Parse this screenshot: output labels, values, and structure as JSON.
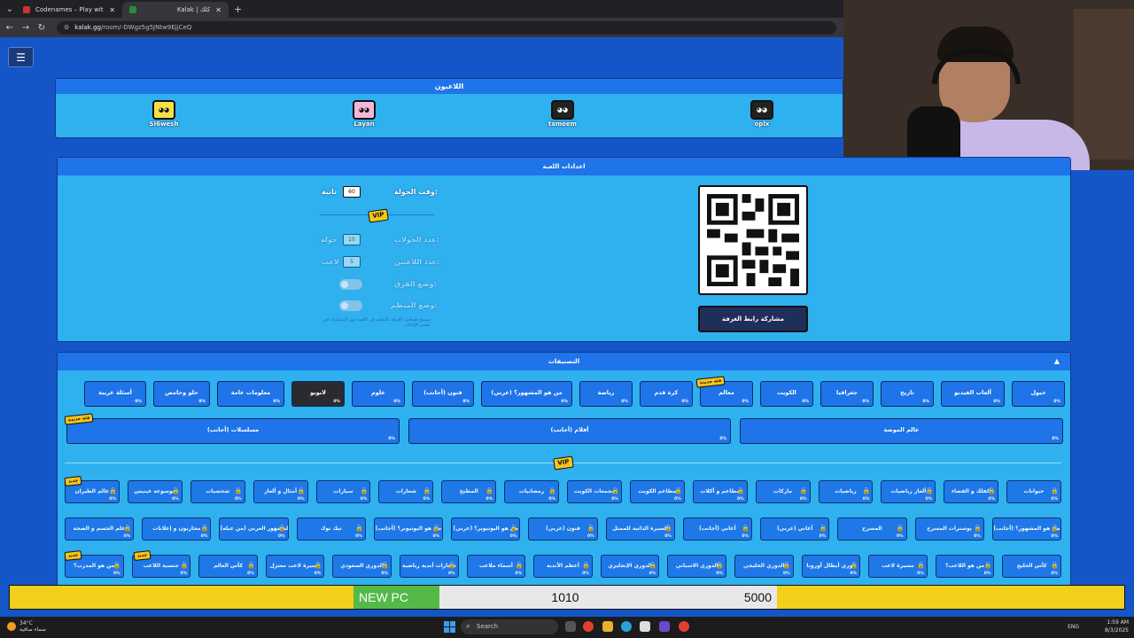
{
  "browser": {
    "tabs": [
      {
        "title": "Codenames – Play with your Fr"
      },
      {
        "title": "Kalak | كلك"
      }
    ],
    "new_tab": "+",
    "url_host": "kalak.gg",
    "url_path": "/room/-DWgz5g5JNtw9EjjCeQ"
  },
  "players": {
    "title": "اللاعبون",
    "list": [
      {
        "name": "SI6wesh",
        "color": "#f6e04a"
      },
      {
        "name": "Layan",
        "color": "#f3b6d6"
      },
      {
        "name": "tameem",
        "color": "#222222"
      },
      {
        "name": "oplx",
        "color": "#222222"
      }
    ]
  },
  "settings": {
    "title": "اعدادات اللعبة",
    "round_time_label": "وقت الجولة:",
    "round_time_value": "60",
    "round_time_unit": "ثانية",
    "vip": "VIP",
    "rounds_label": "عدد الجولات:",
    "rounds_value": "10",
    "rounds_unit": "جولة",
    "players_label": "عدد اللاعبين:",
    "players_value": "5",
    "players_unit": "لاعب",
    "teams_label": "وضع الفرق:",
    "host_label": "وضع المنظم:",
    "note": "يسمح لصاحب الغرفة بالتحكم في اللعبة دون المشاركة في تقديم الإجابات",
    "share_label": "مشاركة رابط الغرفة"
  },
  "categories": {
    "title": "التصنيفات",
    "new_badge": "فئة جديدة",
    "free_row": [
      {
        "label": "خيول",
        "pct": "0%"
      },
      {
        "label": "ألعاب الفيديو",
        "pct": "0%"
      },
      {
        "label": "تاريخ",
        "pct": "0%"
      },
      {
        "label": "جغرافيا",
        "pct": "0%"
      },
      {
        "label": "الكويت",
        "pct": "0%"
      },
      {
        "label": "معالم",
        "pct": "0%"
      },
      {
        "label": "كرة قدم",
        "pct": "0%"
      },
      {
        "label": "رياضة",
        "pct": "0%"
      },
      {
        "label": "من هو المشهور؟ (عربي)",
        "pct": "0%"
      },
      {
        "label": "فنون (أجانب)",
        "pct": "0%"
      },
      {
        "label": "علوم",
        "pct": "0%"
      },
      {
        "label": "لابوبو",
        "pct": "0%"
      },
      {
        "label": "معلومات عامة",
        "pct": "0%"
      },
      {
        "label": "حلو وحامض",
        "pct": "0%"
      },
      {
        "label": "أسئلة غريبة",
        "pct": "0%"
      }
    ],
    "wide_row": [
      {
        "label": "عالم الموضة",
        "pct": "0%"
      },
      {
        "label": "أفلام (أجانب)",
        "pct": "0%"
      },
      {
        "label": "مسلسلات (أجانب)",
        "pct": "0%"
      }
    ],
    "vip": "VIP",
    "vip_badge": "جديد",
    "vip_rows": [
      [
        "حيوانات",
        "الفلك و الفضاء",
        "ألغاز رياضيات",
        "رياضيات",
        "ماركات",
        "مطاعم و أكلات",
        "مطاعم الكويت",
        "مجمعات الكويت",
        "رمضانيات",
        "المطبخ",
        "شعارات",
        "سيارات",
        "أمثال و ألغاز",
        "شخصيات",
        "موسوعة غينيس",
        "عالم الطيران"
      ],
      [
        "من هو المشهور؟ (أجانب)",
        "بوسترات المسرح",
        "المسرح",
        "أغاني (عربي)",
        "أغاني (أجانب)",
        "السيرة الذاتية للممثل",
        "فنون (عربي)",
        "من هو اليوتيوبر؟ (عربي)",
        "من هو اليوتيوبر؟ (أجانب)",
        "تيك توك",
        "من هو المشهور العربي (من عيله)",
        "محاربون و إعلانات",
        "علم الجسم و الصحة"
      ],
      [
        "كأس الخليج",
        "من هو اللاعب؟",
        "مسيرة لاعب",
        "دوري أبطال أوروبا",
        "الدوري الخليجي",
        "الدوري الاسباني",
        "الدوري الإنجليزي",
        "أعظم الأندية",
        "أسماء ملاعب",
        "شعارات أندية رياضية",
        "الدوري السعودي",
        "مسيرة لاعب معتزل",
        "كأس العالم",
        "جنسية اللاعب",
        "من هو المدرب؟"
      ]
    ]
  },
  "stream_goal": {
    "label": "NEW PC",
    "current": "1010",
    "goal": "5000",
    "progress_fraction": 0.202
  },
  "taskbar": {
    "weather_temp": "34°C",
    "weather_desc": "سماء صافية",
    "search": "Search",
    "lang": "ENG",
    "time": "1:59 AM",
    "date": "8/3/2025"
  }
}
